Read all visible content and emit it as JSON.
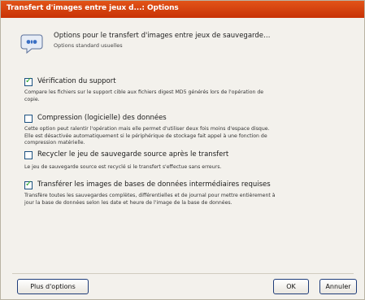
{
  "window": {
    "title": "Transfert d'images entre jeux d...: Options"
  },
  "header": {
    "icon": "options-dialog-icon",
    "title": "Options pour le transfert d'images entre jeux de sauvegarde…",
    "subtitle": "Options standard usuelles"
  },
  "options": [
    {
      "label": "Vérification du support",
      "checked": true,
      "description": "Compare les fichiers sur le support cible aux fichiers digest MD5 générés lors de l'opération de copie."
    },
    {
      "label": "Compression (logicielle) des données",
      "checked": false,
      "description": "Cette option peut ralentir l'opération mais elle permet d'utiliser deux fois moins d'espace disque. Elle est désactivée automatiquement si le périphérique de stockage fait appel à une fonction de compression matérielle."
    },
    {
      "label": "Recycler le jeu de sauvegarde source après le transfert",
      "checked": false,
      "description": "Le jeu de sauvegarde source est recyclé si le transfert s'effectue sans erreurs."
    },
    {
      "label": "Transférer les images de bases de données intermédiaires requises",
      "checked": true,
      "description": "Transfère toutes les sauvegardes complètes, différentielles et de journal pour mettre entièrement à jour la base de données selon les date et heure de l'image de la base de données."
    }
  ],
  "buttons": {
    "more_options": "Plus d'options",
    "ok": "OK",
    "cancel": "Annuler"
  },
  "colors": {
    "titlebar": "#cc3800",
    "checkmark": "#21a121",
    "button_border": "#1f3d7a"
  }
}
